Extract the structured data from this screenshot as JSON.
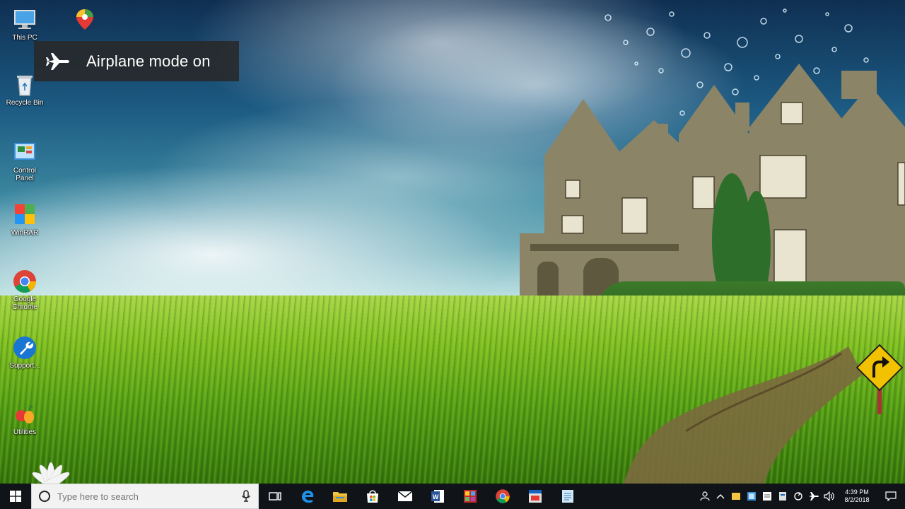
{
  "toast": {
    "text": "Airplane mode on"
  },
  "desktop_icons": [
    {
      "label": "This PC"
    },
    {
      "label": "Recycle Bin"
    },
    {
      "label": "Control Panel"
    },
    {
      "label": "WinRAR"
    },
    {
      "label": "Google Chrome"
    },
    {
      "label": "Support..."
    },
    {
      "label": "Utilities"
    }
  ],
  "taskbar": {
    "search_placeholder": "Type here to search",
    "apps": [
      "task-view",
      "edge",
      "file-explorer",
      "store",
      "mail",
      "word",
      "media",
      "chrome",
      "app",
      "notepad"
    ],
    "clock_time": "4:39 PM",
    "clock_date": "8/2/2018"
  },
  "colors": {
    "taskbar": "#101418",
    "toast_bg": "#282828",
    "accent": "#0078d7"
  }
}
